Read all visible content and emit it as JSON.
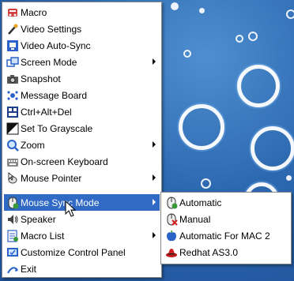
{
  "menu": {
    "items": [
      {
        "label": "Macro",
        "icon": "macro-icon",
        "arrow": false
      },
      {
        "label": "Video Settings",
        "icon": "video-settings-icon",
        "arrow": false
      },
      {
        "label": "Video Auto-Sync",
        "icon": "video-auto-sync-icon",
        "arrow": false
      },
      {
        "label": "Screen Mode",
        "icon": "screen-mode-icon",
        "arrow": true
      },
      {
        "label": "Snapshot",
        "icon": "snapshot-icon",
        "arrow": false
      },
      {
        "label": "Message Board",
        "icon": "message-board-icon",
        "arrow": false
      },
      {
        "label": "Ctrl+Alt+Del",
        "icon": "ctrl-alt-del-icon",
        "arrow": false
      },
      {
        "label": "Set To Grayscale",
        "icon": "grayscale-icon",
        "arrow": false
      },
      {
        "label": "Zoom",
        "icon": "zoom-icon",
        "arrow": true
      },
      {
        "label": "On-screen Keyboard",
        "icon": "keyboard-icon",
        "arrow": false
      },
      {
        "label": "Mouse Pointer",
        "icon": "mouse-pointer-icon",
        "arrow": true
      },
      {
        "label": "Mouse Sync Mode",
        "icon": "mouse-sync-icon",
        "arrow": true,
        "highlighted": true
      },
      {
        "label": "Speaker",
        "icon": "speaker-icon",
        "arrow": false
      },
      {
        "label": "Macro List",
        "icon": "macro-list-icon",
        "arrow": true
      },
      {
        "label": "Customize Control Panel",
        "icon": "customize-icon",
        "arrow": false
      },
      {
        "label": "Exit",
        "icon": "exit-icon",
        "arrow": false
      }
    ]
  },
  "submenu": {
    "items": [
      {
        "label": "Automatic",
        "icon": "mouse-automatic-icon"
      },
      {
        "label": "Manual",
        "icon": "mouse-manual-icon"
      },
      {
        "label": "Automatic For MAC 2",
        "icon": "apple-icon"
      },
      {
        "label": "Redhat AS3.0",
        "icon": "redhat-icon"
      }
    ]
  },
  "colors": {
    "highlight": "#316ac5",
    "desktop": "#2c68b0"
  }
}
